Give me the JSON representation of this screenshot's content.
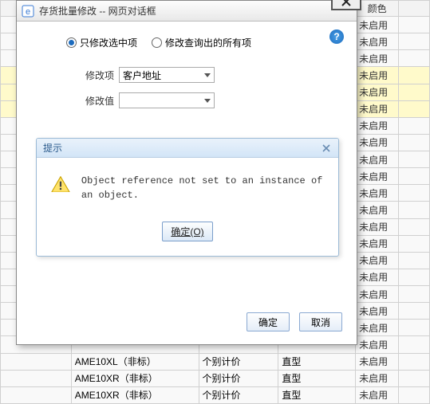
{
  "grid": {
    "headers": [
      "",
      "",
      "",
      "",
      "颜色",
      ""
    ],
    "rows": [
      {
        "c": [
          "",
          "",
          "",
          "",
          "未启用",
          ""
        ]
      },
      {
        "c": [
          "",
          "",
          "",
          "",
          "未启用",
          ""
        ]
      },
      {
        "c": [
          "",
          "",
          "",
          "",
          "未启用",
          ""
        ]
      },
      {
        "c": [
          "",
          "",
          "",
          "",
          "未启用",
          ""
        ],
        "hl": true
      },
      {
        "c": [
          "",
          "",
          "",
          "",
          "未启用",
          ""
        ],
        "hl": true
      },
      {
        "c": [
          "",
          "",
          "",
          "",
          "未启用",
          ""
        ],
        "hl": true
      },
      {
        "c": [
          "",
          "",
          "",
          "",
          "未启用",
          ""
        ]
      },
      {
        "c": [
          "",
          "",
          "",
          "",
          "未启用",
          ""
        ]
      },
      {
        "c": [
          "",
          "",
          "",
          "",
          "未启用",
          ""
        ]
      },
      {
        "c": [
          "",
          "",
          "",
          "",
          "未启用",
          ""
        ]
      },
      {
        "c": [
          "",
          "",
          "",
          "",
          "未启用",
          ""
        ]
      },
      {
        "c": [
          "",
          "",
          "",
          "",
          "未启用",
          ""
        ]
      },
      {
        "c": [
          "",
          "",
          "",
          "",
          "未启用",
          ""
        ]
      },
      {
        "c": [
          "",
          "",
          "",
          "",
          "未启用",
          ""
        ]
      },
      {
        "c": [
          "",
          "",
          "",
          "",
          "未启用",
          ""
        ]
      },
      {
        "c": [
          "",
          "",
          "",
          "",
          "未启用",
          ""
        ]
      },
      {
        "c": [
          "",
          "",
          "",
          "",
          "未启用",
          ""
        ]
      },
      {
        "c": [
          "",
          "",
          "",
          "",
          "未启用",
          ""
        ]
      },
      {
        "c": [
          "",
          "",
          "",
          "",
          "未启用",
          ""
        ]
      },
      {
        "c": [
          "",
          "",
          "",
          "",
          "未启用",
          ""
        ]
      },
      {
        "c": [
          "",
          "AME10XL（非标）",
          "个别计价",
          "直型",
          "未启用",
          ""
        ]
      },
      {
        "c": [
          "",
          "AME10XR（非标）",
          "个别计价",
          "直型",
          "未启用",
          ""
        ]
      },
      {
        "c": [
          "",
          "AME10XR（非标）",
          "个别计价",
          "直型",
          "未启用",
          ""
        ]
      }
    ]
  },
  "dialog": {
    "title": "存货批量修改 -- 网页对话框",
    "radios": {
      "selected_only": "只修改选中项",
      "all_query": "修改查询出的所有项"
    },
    "form": {
      "field_label": "修改项",
      "field_value": "客户地址",
      "value_label": "修改值",
      "value_value": ""
    },
    "actions": {
      "ok": "确定",
      "cancel": "取消"
    }
  },
  "msgbox": {
    "title": "提示",
    "text": "Object reference not set to an instance of an object.",
    "ok": "确定(O)"
  }
}
